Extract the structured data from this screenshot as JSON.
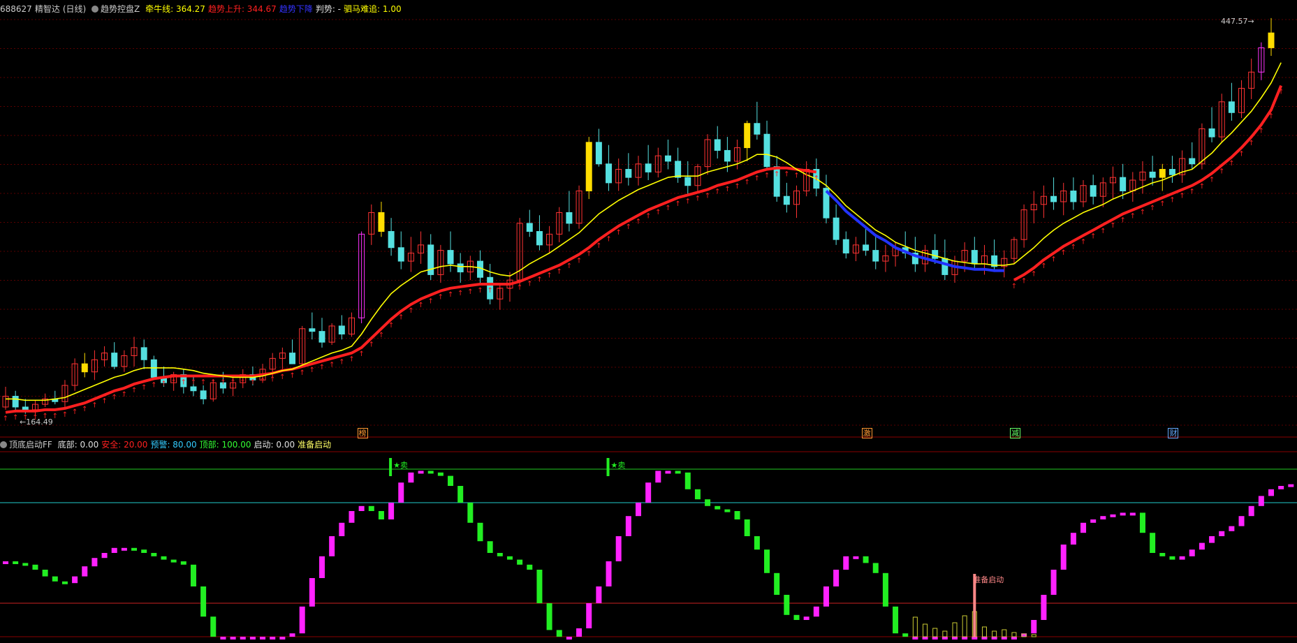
{
  "main_header": {
    "code": "688627",
    "name": "精智达",
    "period": "(日线)",
    "indicator": "趋势控盘Z",
    "items": [
      {
        "label": "牵牛线",
        "value": "364.27",
        "color": "#ffff00"
      },
      {
        "label": "趋势上升",
        "value": "344.67",
        "color": "#ff2020"
      },
      {
        "label": "趋势下降",
        "value": "",
        "color": "#3333ff"
      },
      {
        "label": "判势",
        "value": "-",
        "color": "#e0e0e0"
      },
      {
        "label": "驷马难追",
        "value": "1.00",
        "color": "#ffff00"
      }
    ]
  },
  "price_labels": {
    "high": "447.57",
    "low": "164.49"
  },
  "signal_markers": [
    {
      "text": "榜",
      "bar": 36,
      "color": "#ff9933"
    },
    {
      "text": "激",
      "bar": 87,
      "color": "#ff9933"
    },
    {
      "text": "减",
      "bar": 102,
      "color": "#66ff66"
    },
    {
      "text": "财",
      "bar": 118,
      "color": "#66aaff"
    }
  ],
  "sub_header": {
    "indicator": "顶底启动FF",
    "items": [
      {
        "label": "底部",
        "value": "0.00",
        "color": "#e0e0e0"
      },
      {
        "label": "安全",
        "value": "20.00",
        "color": "#ff2020"
      },
      {
        "label": "预警",
        "value": "80.00",
        "color": "#33ccff"
      },
      {
        "label": "顶部",
        "value": "100.00",
        "color": "#33ff33"
      },
      {
        "label": "启动",
        "value": "0.00",
        "color": "#e0e0e0"
      },
      {
        "label": "准备启动",
        "value": "",
        "color": "#ffff66"
      }
    ]
  },
  "sell_labels": [
    {
      "text": "★卖",
      "bar": 39
    },
    {
      "text": "★卖",
      "bar": 61
    }
  ],
  "launch_label": {
    "text": "准备启动",
    "bar": 98
  },
  "chart_data": [
    {
      "type": "candlestick",
      "title": "",
      "ylim": [
        155,
        460
      ],
      "ohlc": [
        [
          170,
          185,
          168,
          178
        ],
        [
          178,
          182,
          166,
          170
        ],
        [
          170,
          176,
          165,
          168
        ],
        [
          168,
          175,
          164,
          172
        ],
        [
          172,
          180,
          170,
          176
        ],
        [
          176,
          182,
          172,
          174
        ],
        [
          174,
          190,
          170,
          186
        ],
        [
          186,
          206,
          182,
          202
        ],
        [
          202,
          210,
          192,
          196
        ],
        [
          196,
          212,
          190,
          205
        ],
        [
          205,
          215,
          200,
          210
        ],
        [
          210,
          218,
          198,
          200
        ],
        [
          200,
          212,
          196,
          208
        ],
        [
          208,
          222,
          200,
          214
        ],
        [
          214,
          220,
          198,
          205
        ],
        [
          205,
          208,
          190,
          192
        ],
        [
          192,
          200,
          185,
          188
        ],
        [
          188,
          196,
          182,
          194
        ],
        [
          194,
          198,
          180,
          185
        ],
        [
          185,
          192,
          178,
          182
        ],
        [
          182,
          186,
          172,
          176
        ],
        [
          176,
          190,
          174,
          188
        ],
        [
          188,
          196,
          180,
          184
        ],
        [
          184,
          192,
          178,
          188
        ],
        [
          188,
          198,
          184,
          194
        ],
        [
          194,
          200,
          186,
          190
        ],
        [
          190,
          202,
          188,
          198
        ],
        [
          198,
          210,
          192,
          206
        ],
        [
          206,
          214,
          198,
          210
        ],
        [
          210,
          220,
          204,
          202
        ],
        [
          202,
          230,
          200,
          228
        ],
        [
          228,
          240,
          220,
          226
        ],
        [
          226,
          236,
          214,
          218
        ],
        [
          218,
          232,
          216,
          230
        ],
        [
          230,
          238,
          220,
          224
        ],
        [
          224,
          240,
          222,
          236
        ],
        [
          236,
          300,
          232,
          298
        ],
        [
          298,
          320,
          290,
          314
        ],
        [
          314,
          322,
          296,
          300
        ],
        [
          300,
          310,
          282,
          288
        ],
        [
          288,
          300,
          272,
          278
        ],
        [
          278,
          296,
          270,
          284
        ],
        [
          284,
          300,
          276,
          290
        ],
        [
          290,
          298,
          264,
          268
        ],
        [
          268,
          290,
          262,
          286
        ],
        [
          286,
          300,
          270,
          276
        ],
        [
          276,
          284,
          262,
          270
        ],
        [
          270,
          282,
          264,
          278
        ],
        [
          278,
          286,
          262,
          266
        ],
        [
          266,
          276,
          246,
          250
        ],
        [
          250,
          262,
          242,
          258
        ],
        [
          258,
          270,
          248,
          264
        ],
        [
          264,
          310,
          260,
          306
        ],
        [
          306,
          316,
          296,
          300
        ],
        [
          300,
          312,
          286,
          290
        ],
        [
          290,
          304,
          284,
          298
        ],
        [
          298,
          318,
          292,
          314
        ],
        [
          314,
          330,
          300,
          306
        ],
        [
          306,
          334,
          302,
          330
        ],
        [
          330,
          370,
          324,
          366
        ],
        [
          366,
          376,
          348,
          350
        ],
        [
          350,
          364,
          330,
          336
        ],
        [
          336,
          354,
          330,
          346
        ],
        [
          346,
          358,
          334,
          340
        ],
        [
          340,
          356,
          334,
          350
        ],
        [
          350,
          364,
          338,
          344
        ],
        [
          344,
          362,
          340,
          356
        ],
        [
          356,
          368,
          346,
          352
        ],
        [
          352,
          362,
          336,
          340
        ],
        [
          340,
          352,
          328,
          334
        ],
        [
          334,
          350,
          330,
          348
        ],
        [
          348,
          372,
          342,
          368
        ],
        [
          368,
          378,
          354,
          360
        ],
        [
          360,
          370,
          344,
          352
        ],
        [
          352,
          368,
          346,
          362
        ],
        [
          362,
          382,
          352,
          380
        ],
        [
          380,
          396,
          368,
          372
        ],
        [
          372,
          382,
          346,
          348
        ],
        [
          348,
          356,
          322,
          326
        ],
        [
          326,
          336,
          314,
          320
        ],
        [
          320,
          334,
          310,
          330
        ],
        [
          330,
          352,
          326,
          346
        ],
        [
          346,
          354,
          326,
          332
        ],
        [
          332,
          342,
          306,
          310
        ],
        [
          310,
          320,
          290,
          294
        ],
        [
          294,
          300,
          280,
          284
        ],
        [
          284,
          296,
          278,
          290
        ],
        [
          290,
          302,
          282,
          286
        ],
        [
          286,
          298,
          272,
          278
        ],
        [
          278,
          290,
          270,
          282
        ],
        [
          282,
          292,
          274,
          288
        ],
        [
          288,
          300,
          280,
          284
        ],
        [
          284,
          296,
          270,
          276
        ],
        [
          276,
          290,
          270,
          286
        ],
        [
          286,
          298,
          276,
          280
        ],
        [
          280,
          294,
          264,
          268
        ],
        [
          268,
          282,
          262,
          278
        ],
        [
          278,
          292,
          270,
          286
        ],
        [
          286,
          296,
          272,
          276
        ],
        [
          276,
          290,
          268,
          282
        ],
        [
          282,
          294,
          270,
          274
        ],
        [
          274,
          286,
          266,
          280
        ],
        [
          280,
          296,
          276,
          294
        ],
        [
          294,
          320,
          288,
          316
        ],
        [
          316,
          330,
          306,
          320
        ],
        [
          320,
          334,
          310,
          326
        ],
        [
          326,
          340,
          316,
          322
        ],
        [
          322,
          336,
          312,
          330
        ],
        [
          330,
          340,
          316,
          322
        ],
        [
          322,
          338,
          318,
          334
        ],
        [
          334,
          342,
          320,
          326
        ],
        [
          326,
          340,
          318,
          336
        ],
        [
          336,
          348,
          324,
          340
        ],
        [
          340,
          350,
          324,
          330
        ],
        [
          330,
          344,
          322,
          338
        ],
        [
          338,
          352,
          328,
          344
        ],
        [
          344,
          356,
          334,
          340
        ],
        [
          340,
          350,
          330,
          346
        ],
        [
          346,
          356,
          336,
          342
        ],
        [
          342,
          360,
          336,
          354
        ],
        [
          354,
          366,
          346,
          350
        ],
        [
          350,
          380,
          346,
          376
        ],
        [
          376,
          392,
          366,
          370
        ],
        [
          370,
          402,
          366,
          396
        ],
        [
          396,
          410,
          382,
          388
        ],
        [
          388,
          412,
          384,
          406
        ],
        [
          406,
          428,
          398,
          418
        ],
        [
          418,
          440,
          412,
          436
        ],
        [
          436,
          458,
          430,
          447
        ]
      ],
      "series": [
        {
          "name": "牵牛线",
          "color": "#ffff00",
          "values": [
            176,
            176,
            175,
            175,
            175,
            176,
            177,
            180,
            183,
            186,
            189,
            192,
            194,
            197,
            199,
            199,
            199,
            199,
            198,
            197,
            195,
            194,
            193,
            192,
            192,
            192,
            193,
            195,
            197,
            198,
            201,
            204,
            207,
            210,
            212,
            215,
            224,
            235,
            245,
            254,
            260,
            265,
            270,
            272,
            274,
            275,
            274,
            274,
            273,
            270,
            268,
            267,
            271,
            276,
            280,
            284,
            289,
            294,
            299,
            306,
            313,
            318,
            323,
            327,
            331,
            334,
            337,
            340,
            341,
            341,
            341,
            344,
            346,
            348,
            350,
            353,
            357,
            357,
            355,
            351,
            346,
            342,
            339,
            334,
            327,
            319,
            313,
            307,
            301,
            297,
            292,
            289,
            286,
            284,
            282,
            280,
            278,
            277,
            276,
            276,
            275,
            275,
            276,
            282,
            288,
            295,
            301,
            306,
            310,
            314,
            317,
            320,
            324,
            327,
            330,
            333,
            336,
            338,
            341,
            344,
            346,
            352,
            358,
            366,
            373,
            381,
            389,
            399,
            410,
            425
          ]
        },
        {
          "name": "趋势上升",
          "color": "#ff2020",
          "values": [
            166,
            167,
            167,
            167,
            168,
            168,
            169,
            171,
            173,
            176,
            179,
            182,
            184,
            187,
            189,
            191,
            192,
            193,
            193,
            193,
            193,
            193,
            193,
            193,
            193,
            193,
            194,
            195,
            197,
            198,
            200,
            202,
            204,
            206,
            208,
            210,
            214,
            221,
            228,
            235,
            241,
            246,
            250,
            253,
            256,
            258,
            259,
            260,
            261,
            261,
            261,
            261,
            263,
            266,
            269,
            272,
            275,
            279,
            283,
            288,
            294,
            299,
            304,
            308,
            312,
            316,
            319,
            322,
            325,
            327,
            329,
            331,
            334,
            336,
            338,
            341,
            344,
            346,
            347,
            347,
            346,
            345,
            344,
            null,
            null,
            null,
            null,
            null,
            null,
            null,
            null,
            null,
            null,
            null,
            null,
            null,
            null,
            null,
            null,
            null,
            null,
            null,
            264,
            268,
            273,
            279,
            284,
            289,
            293,
            297,
            301,
            305,
            309,
            313,
            316,
            319,
            322,
            325,
            328,
            331,
            334,
            338,
            343,
            349,
            355,
            362,
            370,
            379,
            390,
            408
          ]
        }
      ]
    },
    {
      "type": "bar",
      "title": "",
      "ylim": [
        0,
        105
      ],
      "reference_lines": [
        0,
        20,
        80,
        100
      ],
      "values": [
        45,
        44,
        43,
        40,
        36,
        33,
        32,
        36,
        42,
        47,
        50,
        53,
        53,
        52,
        50,
        48,
        46,
        45,
        43,
        30,
        12,
        0,
        0,
        0,
        0,
        0,
        0,
        0,
        0,
        2,
        18,
        35,
        48,
        60,
        68,
        75,
        78,
        75,
        70,
        80,
        92,
        98,
        99,
        98,
        96,
        90,
        80,
        68,
        57,
        50,
        48,
        46,
        43,
        40,
        20,
        4,
        0,
        0,
        5,
        20,
        30,
        45,
        60,
        72,
        80,
        92,
        99,
        99,
        98,
        88,
        82,
        78,
        76,
        75,
        70,
        60,
        52,
        38,
        25,
        13,
        10,
        12,
        18,
        30,
        40,
        48,
        48,
        44,
        38,
        18,
        2,
        0,
        0,
        0,
        0,
        0,
        0,
        0,
        0,
        0,
        0,
        0,
        0,
        2,
        10,
        25,
        40,
        55,
        62,
        68,
        70,
        72,
        73,
        74,
        74,
        62,
        50,
        48,
        46,
        48,
        52,
        56,
        60,
        63,
        66,
        72,
        78,
        84,
        88,
        90,
        91,
        92,
        92,
        94,
        98,
        100,
        100
      ]
    }
  ]
}
